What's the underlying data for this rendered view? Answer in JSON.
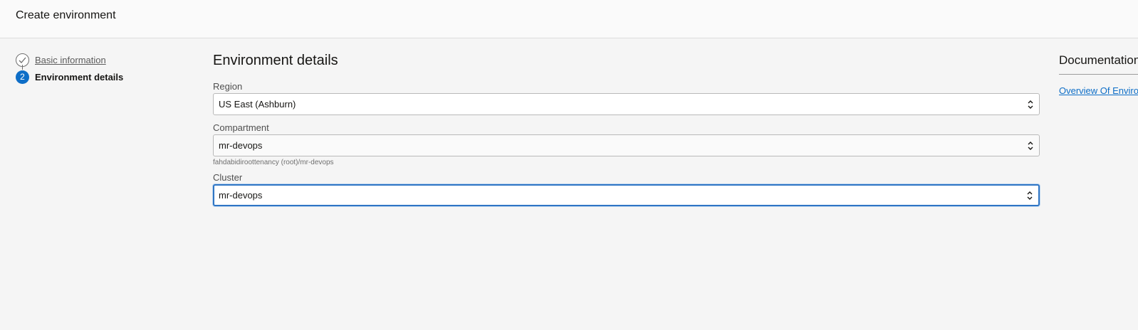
{
  "header": {
    "title": "Create environment"
  },
  "steps": [
    {
      "label": "Basic information",
      "state": "done",
      "icon": "check-icon"
    },
    {
      "label": "Environment details",
      "state": "current",
      "number": "2"
    }
  ],
  "main": {
    "title": "Environment details",
    "fields": {
      "region": {
        "label": "Region",
        "value": "US East (Ashburn)"
      },
      "compartment": {
        "label": "Compartment",
        "value": "mr-devops",
        "hint": "fahdabidiroottenancy (root)/mr-devops"
      },
      "cluster": {
        "label": "Cluster",
        "value": "mr-devops"
      }
    }
  },
  "documentation": {
    "title": "Documentation",
    "link": "Overview Of Environments"
  },
  "colors": {
    "accent": "#0e6ec7",
    "focus": "#2f75c4",
    "background": "#f5f5f5"
  }
}
